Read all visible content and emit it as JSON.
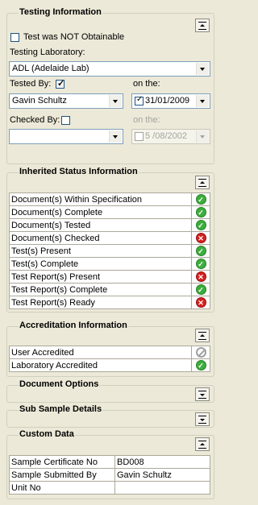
{
  "testing": {
    "title": "Testing Information",
    "not_obtainable_label": "Test was NOT Obtainable",
    "laboratory_label": "Testing Laboratory:",
    "laboratory_value": "ADL (Adelaide Lab)",
    "tested_by_label": "Tested By:",
    "tested_by_value": "Gavin Schultz",
    "tested_on_label": "on the:",
    "tested_date": "31/01/2009",
    "checked_by_label": "Checked By:",
    "checked_by_value": "",
    "checked_on_label": "on the:",
    "checked_date": "5 /08/2002"
  },
  "inherited": {
    "title": "Inherited Status Information",
    "rows": [
      {
        "label": "Document(s) Within Specification",
        "status": "pass"
      },
      {
        "label": "Document(s) Complete",
        "status": "pass"
      },
      {
        "label": "Document(s) Tested",
        "status": "pass"
      },
      {
        "label": "Document(s) Checked",
        "status": "fail"
      },
      {
        "label": "Test(s) Present",
        "status": "pass"
      },
      {
        "label": "Test(s) Complete",
        "status": "pass"
      },
      {
        "label": "Test Report(s) Present",
        "status": "fail"
      },
      {
        "label": "Test Report(s) Complete",
        "status": "pass"
      },
      {
        "label": "Test Report(s) Ready",
        "status": "fail"
      }
    ]
  },
  "accreditation": {
    "title": "Accreditation Information",
    "rows": [
      {
        "label": "User Accredited",
        "status": "na"
      },
      {
        "label": "Laboratory Accredited",
        "status": "pass"
      }
    ]
  },
  "document_options": {
    "title": "Document Options"
  },
  "sub_sample": {
    "title": "Sub Sample Details"
  },
  "custom": {
    "title": "Custom Data",
    "rows": [
      {
        "label": "Sample Certificate No",
        "value": "BD008"
      },
      {
        "label": "Sample Submitted By",
        "value": "Gavin Schultz"
      },
      {
        "label": "Unit No",
        "value": ""
      }
    ]
  },
  "colors": {
    "background": "#ece9d8",
    "pass": "#3cae3c",
    "fail": "#d42020",
    "na": "#a0a0a0"
  }
}
